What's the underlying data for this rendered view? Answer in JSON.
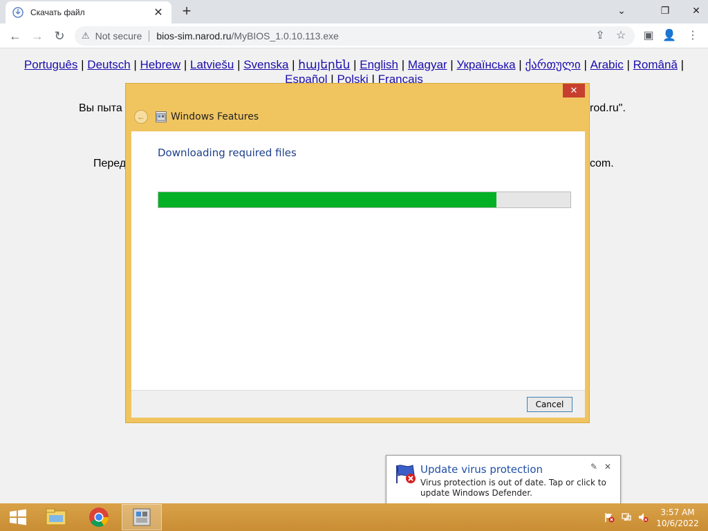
{
  "browser": {
    "tab_title": "Скачать файл",
    "tab_close": "✕",
    "new_tab": "+",
    "window_controls": {
      "minimize": "⌄",
      "restore": "❐",
      "close": "✕"
    },
    "nav": {
      "back": "←",
      "forward": "→",
      "reload": "↻"
    },
    "security_warning_icon": "⚠",
    "security_label": "Not secure",
    "url_host": "bios-sim.narod.ru",
    "url_path": "/MyBIOS_1.0.10.113.exe",
    "toolbar_icons": {
      "share": "⇪",
      "bookmark": "☆",
      "sidepanel": "▣",
      "profile": "👤",
      "menu": "⋮"
    }
  },
  "page": {
    "languages_line1": [
      "Português",
      "Deutsch",
      "Hebrew",
      "Latviešu",
      "Svenska",
      "հայերեն",
      "English",
      "Magyar",
      "Українська",
      "ქართული",
      "Arabic",
      "Română"
    ],
    "languages_line2": [
      "Español",
      "Polski",
      "Français"
    ],
    "separator": " | ",
    "trailing_separator": " |",
    "text_left_1": "Вы пыта",
    "text_right_1": "rod.ru\".",
    "text_left_2": "Перед",
    "text_right_2": "com."
  },
  "dialog": {
    "close_label": "✕",
    "back_icon": "←",
    "title": "Windows Features",
    "heading": "Downloading required files",
    "progress_percent": 82,
    "cancel_label": "Cancel"
  },
  "notification": {
    "title": "Update virus protection",
    "body": "Virus protection is out of date. Tap or click to update Windows Defender.",
    "pin_icon": "✎",
    "close_icon": "✕"
  },
  "taskbar": {
    "clock_time": "3:57 AM",
    "clock_date": "10/6/2022"
  },
  "colors": {
    "dialog_frame": "#f0c560",
    "progress_fill": "#06b025",
    "taskbar": "#d9a248",
    "link": "#1a0dab"
  }
}
